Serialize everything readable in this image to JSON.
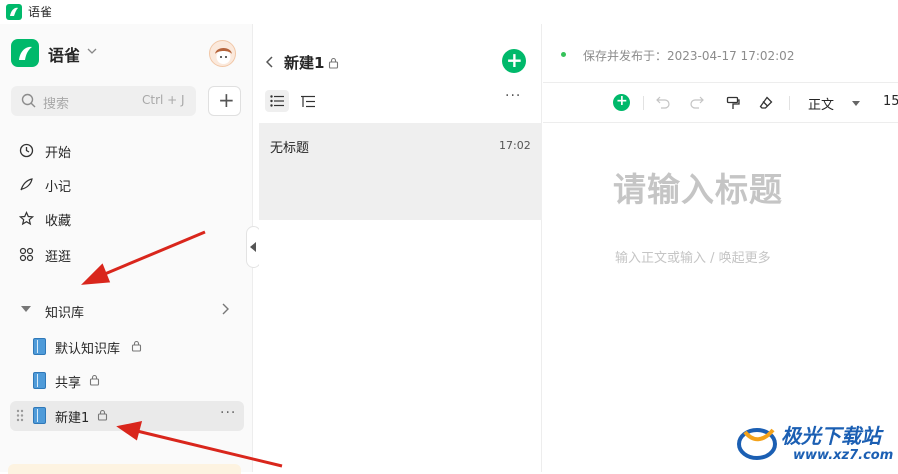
{
  "window": {
    "title": "语雀"
  },
  "sidebar": {
    "app_name": "语雀",
    "search": {
      "placeholder": "搜索",
      "shortcut": "Ctrl + J"
    },
    "nav_items": [
      {
        "label": "开始",
        "icon": "clock-icon"
      },
      {
        "label": "小记",
        "icon": "feather-icon"
      },
      {
        "label": "收藏",
        "icon": "star-icon"
      },
      {
        "label": "逛逛",
        "icon": "grid-icon"
      }
    ],
    "knowledge_base": {
      "label": "知识库",
      "items": [
        {
          "label": "默认知识库",
          "locked": true,
          "selected": false
        },
        {
          "label": "共享",
          "locked": true,
          "selected": false
        },
        {
          "label": "新建1",
          "locked": true,
          "selected": true
        }
      ]
    }
  },
  "doclist": {
    "title": "新建1",
    "docs": [
      {
        "name": "无标题",
        "time": "17:02"
      }
    ]
  },
  "editor": {
    "save_status": "保存并发布于：2023-04-17 17:02:02",
    "toolbar": {
      "paragraph_style": "正文",
      "font_size": "15"
    },
    "title_placeholder": "请输入标题",
    "body_placeholder": "输入正文或输入 / 唤起更多"
  },
  "colors": {
    "accent": "#00b96b",
    "annotation_arrow": "#d9261c",
    "book_icon": "#4f9bd9"
  },
  "watermark": {
    "text": "极光下载站",
    "url": "www.xz7.com"
  }
}
